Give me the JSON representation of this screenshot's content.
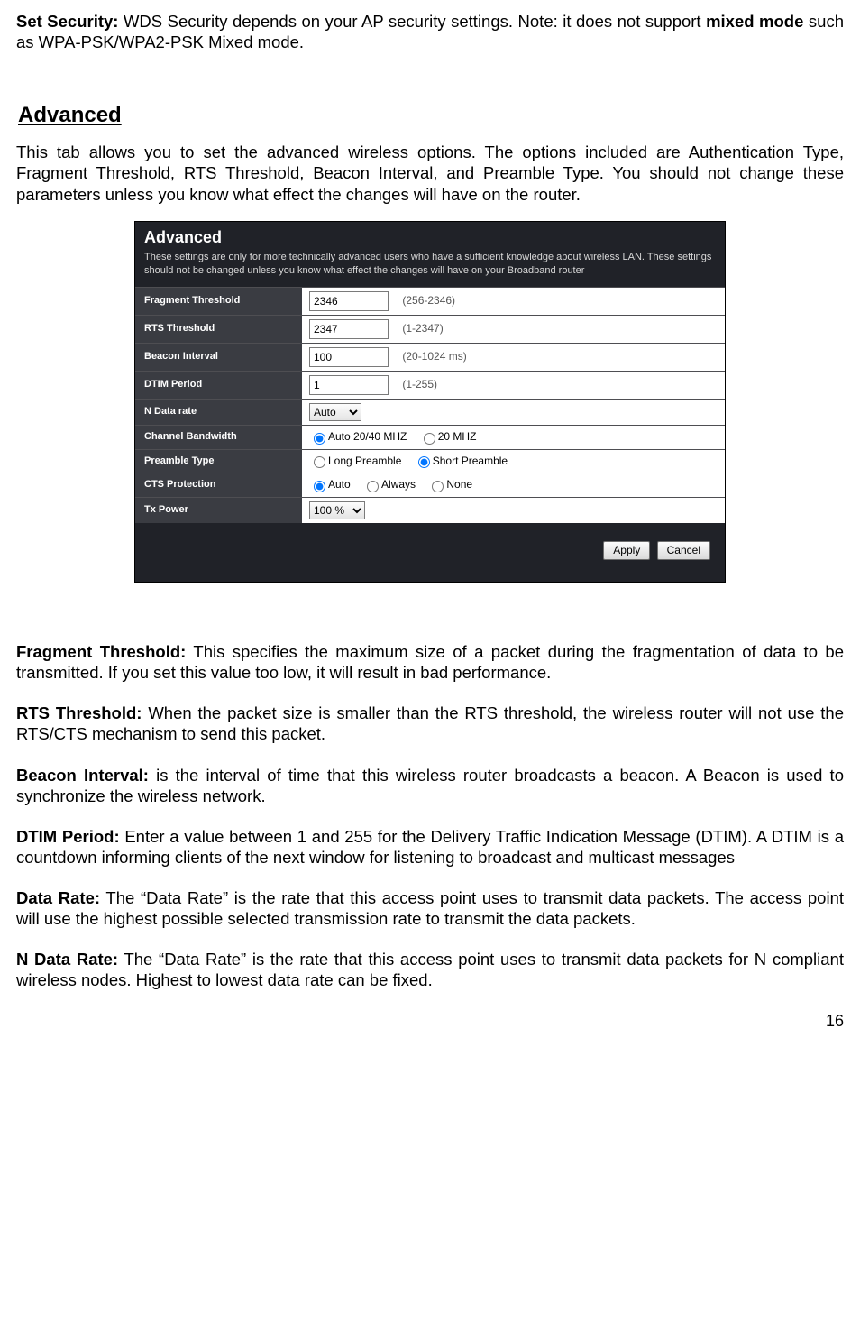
{
  "intro": {
    "lead_label": "Set Security:",
    "lead_text": " WDS Security depends on your AP security settings. Note: it does not support ",
    "bold_tail": "mixed mode",
    "tail_text": " such as WPA-PSK/WPA2-PSK Mixed mode."
  },
  "section": {
    "heading": "Advanced",
    "desc": "This tab allows you to set the advanced wireless options. The options included are Authentication Type, Fragment Threshold, RTS Threshold, Beacon Interval, and Preamble Type. You should not change these parameters unless you know what effect the changes will have on the router."
  },
  "panel": {
    "title": "Advanced",
    "subtitle": "These settings are only for more technically advanced users who have a sufficient knowledge about wireless LAN. These settings should not be changed unless you know what effect the changes will have on your Broadband router",
    "rows": {
      "fragment": {
        "label": "Fragment Threshold",
        "value": "2346",
        "range": "(256-2346)"
      },
      "rts": {
        "label": "RTS Threshold",
        "value": "2347",
        "range": "(1-2347)"
      },
      "beacon": {
        "label": "Beacon Interval",
        "value": "100",
        "range": "(20-1024 ms)"
      },
      "dtim": {
        "label": "DTIM Period",
        "value": "1",
        "range": "(1-255)"
      },
      "ndata": {
        "label": "N  Data rate",
        "selected": "Auto"
      },
      "cbw": {
        "label": "Channel Bandwidth",
        "opt1": "Auto 20/40 MHZ",
        "opt2": "20 MHZ"
      },
      "preamble": {
        "label": "Preamble Type",
        "opt1": "Long Preamble",
        "opt2": "Short Preamble"
      },
      "cts": {
        "label": "CTS Protection",
        "opt1": "Auto",
        "opt2": "Always",
        "opt3": "None"
      },
      "tx": {
        "label": "Tx Power",
        "selected": "100 %"
      }
    },
    "buttons": {
      "apply": "Apply",
      "cancel": "Cancel"
    }
  },
  "defs": {
    "fragment": {
      "label": "Fragment Threshold:",
      "text": " This specifies the maximum size of a packet during the fragmentation of data to be transmitted. If you set this value too low, it will result in bad performance."
    },
    "rts": {
      "label": "RTS Threshold:",
      "text": " When the packet size is smaller than the RTS threshold, the wireless router will not use the RTS/CTS mechanism to send this packet."
    },
    "beacon": {
      "label": "Beacon Interval:",
      "text": " is the interval of time that this wireless router broadcasts a beacon. A Beacon is used to synchronize the wireless network."
    },
    "dtim": {
      "label": "DTIM Period:",
      "text": " Enter a value between 1 and 255 for the Delivery Traffic Indication Message (DTIM). A DTIM is a countdown informing clients of the next window for listening to broadcast and multicast messages"
    },
    "datarate": {
      "label": "Data Rate:",
      "text": " The “Data Rate” is the rate that this access point uses to transmit data packets. The access point will use the highest possible selected transmission rate to transmit the data packets."
    },
    "ndata": {
      "label": "N Data Rate:",
      "text": " The “Data Rate” is the rate that this access point uses to transmit data packets for N compliant wireless nodes. Highest to lowest data rate can be fixed."
    }
  },
  "page_number": "16"
}
